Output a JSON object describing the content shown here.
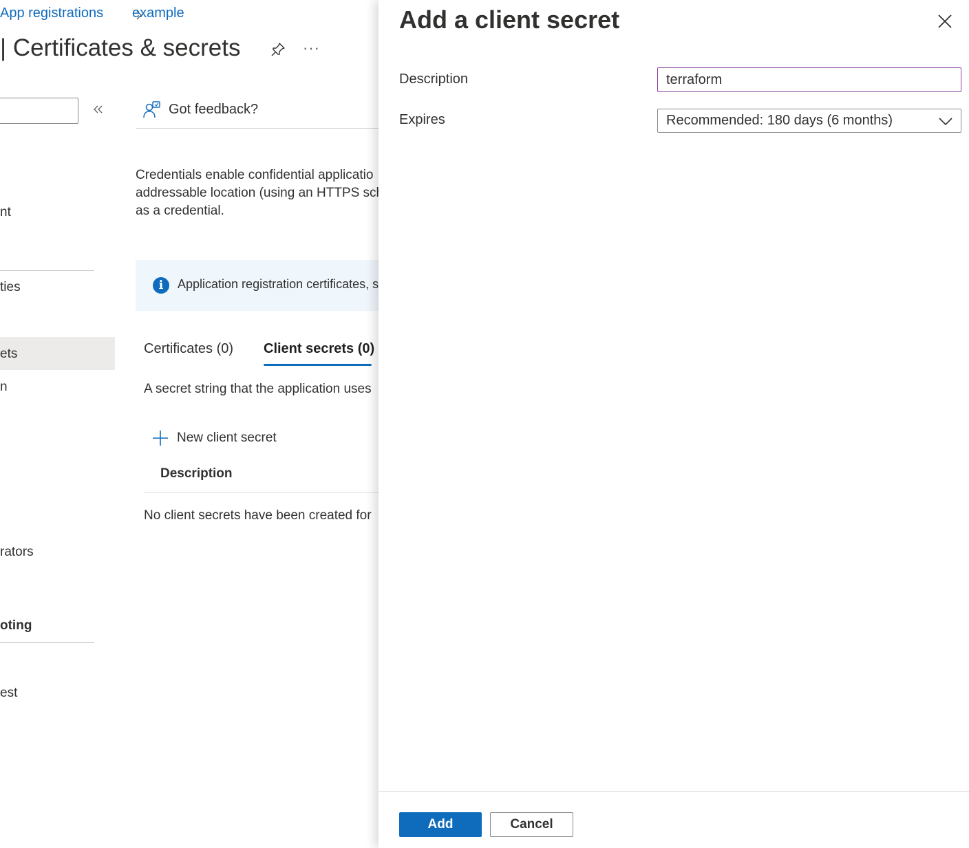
{
  "breadcrumb": {
    "items": [
      "App registrations",
      "example"
    ]
  },
  "page": {
    "title": "| Certificates & secrets"
  },
  "sidebar": {
    "items": [
      "nt",
      "ties",
      "ets",
      "n",
      "rators",
      "oting",
      "est"
    ]
  },
  "toolbar": {
    "feedback_label": "Got feedback?"
  },
  "main": {
    "description_lines": [
      "Credentials enable confidential applicatio",
      "addressable location (using an HTTPS sch",
      "as a credential."
    ],
    "info_text": "Application registration certificates, s",
    "tabs": [
      {
        "label": "Certificates (0)",
        "active": false
      },
      {
        "label": "Client secrets (0)",
        "active": true
      }
    ],
    "secret_description": "A secret string that the application uses",
    "new_secret_label": "New client secret",
    "table": {
      "column_header": "Description",
      "empty_text": "No client secrets have been created for"
    }
  },
  "panel": {
    "title": "Add a client secret",
    "description_label": "Description",
    "description_value": "terraform",
    "expires_label": "Expires",
    "expires_value": "Recommended: 180 days (6 months)",
    "add_label": "Add",
    "cancel_label": "Cancel"
  },
  "colors": {
    "accent": "#0f6cbd",
    "focus_border": "#8a3f9d",
    "selected_nav": "#edebe9",
    "info_background": "#eff6fc"
  },
  "icons": [
    "chevron-right-icon",
    "pin-icon",
    "more-icon",
    "double-chevron-left-icon",
    "feedback-icon",
    "info-icon",
    "plus-icon",
    "close-icon",
    "chevron-down-icon"
  ]
}
